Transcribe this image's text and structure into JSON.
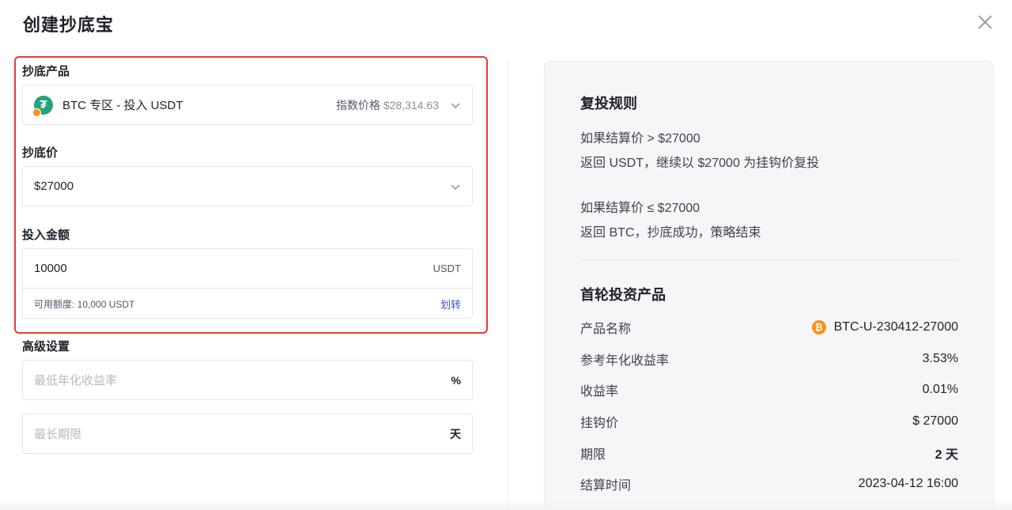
{
  "modal": {
    "title": "创建抄底宝"
  },
  "form": {
    "product_label": "抄底产品",
    "product": {
      "name": "BTC 专区 - 投入 USDT",
      "index_label": "指数价格",
      "index_value": "$28,314.63",
      "icon": "tether-icon"
    },
    "price_label": "抄底价",
    "price_value": "$27000",
    "amount_label": "投入金额",
    "amount_value": "10000",
    "amount_unit": "USDT",
    "available": "可用额度: 10,000 USDT",
    "transfer_label": "划转",
    "advanced_label": "高级设置",
    "min_yield_placeholder": "最低年化收益率",
    "min_yield_suffix": "%",
    "max_term_placeholder": "最长期限",
    "max_term_suffix": "天"
  },
  "rules": {
    "title": "复投规则",
    "line1": "如果结算价 > $27000",
    "line2": "返回 USDT，继续以 $27000 为挂钩价复投",
    "line3": "如果结算价 ≤ $27000",
    "line4": "返回 BTC，抄底成功，策略结束"
  },
  "first_product": {
    "title": "首轮投资产品",
    "rows": [
      {
        "key": "产品名称",
        "value": "BTC-U-230412-27000"
      },
      {
        "key": "参考年化收益率",
        "value": "3.53%"
      },
      {
        "key": "收益率",
        "value": "0.01%"
      },
      {
        "key": "挂钩价",
        "value": "$ 27000"
      },
      {
        "key": "期限",
        "value": "2 天"
      },
      {
        "key": "结算时间",
        "value": "2023-04-12 16:00"
      }
    ]
  },
  "colors": {
    "highlight": "#e8392f",
    "link": "#3451d6",
    "tether": "#26a17b",
    "bitcoin": "#f7931a"
  }
}
